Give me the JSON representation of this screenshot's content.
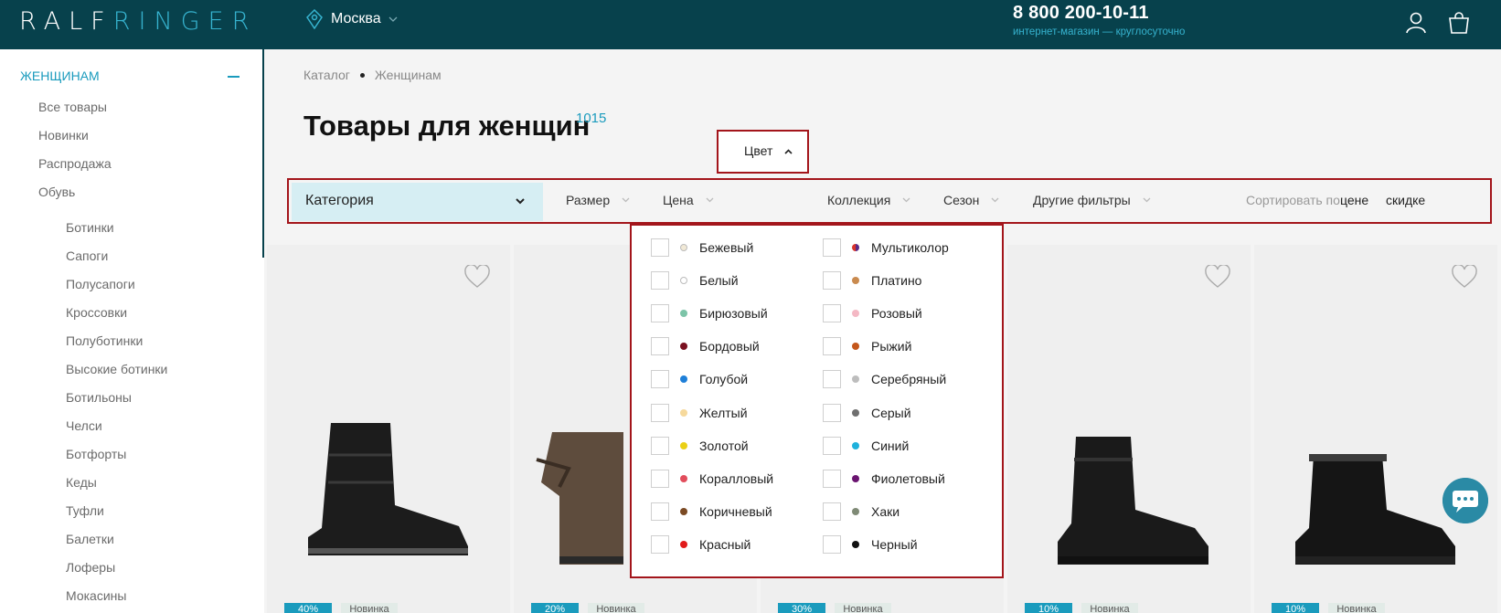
{
  "header": {
    "logo_part1": "RALF",
    "logo_part2": "RINGER",
    "city": "Москва",
    "phone": "8 800 200-10-11",
    "phone_subtitle": "интернет-магазин — круглосуточно"
  },
  "sidebar": {
    "section_title": "ЖЕНЩИНАМ",
    "main_items": [
      "Все товары",
      "Новинки",
      "Распродажа",
      "Обувь"
    ],
    "shoe_items": [
      "Ботинки",
      "Сапоги",
      "Полусапоги",
      "Кроссовки",
      "Полуботинки",
      "Высокие ботинки",
      "Ботильоны",
      "Челси",
      "Ботфорты",
      "Кеды",
      "Туфли",
      "Балетки",
      "Лоферы",
      "Мокасины"
    ]
  },
  "breadcrumb": [
    "Каталог",
    "Женщинам"
  ],
  "page": {
    "title": "Товары для женщин",
    "count": "1015"
  },
  "filters": {
    "category": "Категория",
    "size": "Размер",
    "price": "Цена",
    "color": "Цвет",
    "collection": "Коллекция",
    "season": "Сезон",
    "other": "Другие фильтры",
    "sort_label": "Сортировать по:",
    "sort_price": "цене",
    "sort_discount": "скидке"
  },
  "colors_left": [
    {
      "label": "Бежевый",
      "color": "#f1e9d6",
      "outline": true
    },
    {
      "label": "Белый",
      "color": "#ffffff",
      "outline": true
    },
    {
      "label": "Бирюзовый",
      "color": "#7cc4a8"
    },
    {
      "label": "Бордовый",
      "color": "#7a1020"
    },
    {
      "label": "Голубой",
      "color": "#1e7fd8"
    },
    {
      "label": "Желтый",
      "color": "#f6d99c"
    },
    {
      "label": "Золотой",
      "color": "#ead016"
    },
    {
      "label": "Коралловый",
      "color": "#e24d5c"
    },
    {
      "label": "Коричневый",
      "color": "#7b4a24"
    },
    {
      "label": "Красный",
      "color": "#e11b1b"
    }
  ],
  "colors_right": [
    {
      "label": "Мультиколор",
      "color": "multi"
    },
    {
      "label": "Платино",
      "color": "#c98a4e"
    },
    {
      "label": "Розовый",
      "color": "#f4b8c4"
    },
    {
      "label": "Рыжий",
      "color": "#c4561a"
    },
    {
      "label": "Серебряный",
      "color": "#bdbdbd"
    },
    {
      "label": "Серый",
      "color": "#6f6f6f"
    },
    {
      "label": "Синий",
      "color": "#1eb1dc"
    },
    {
      "label": "Фиолетовый",
      "color": "#6a1470"
    },
    {
      "label": "Хаки",
      "color": "#7f8a76"
    },
    {
      "label": "Черный",
      "color": "#111111"
    }
  ],
  "products": [
    {
      "discount": "40%",
      "badge": "Новинка",
      "boot": "black-quilted"
    },
    {
      "discount": "20%",
      "badge": "Новинка",
      "boot": "brown-suede"
    },
    {
      "discount": "30%",
      "badge": "Новинка",
      "boot": "hidden"
    },
    {
      "discount": "10%",
      "badge": "Новинка",
      "boot": "black-lace"
    },
    {
      "discount": "10%",
      "badge": "Новинка",
      "boot": "black-fur"
    }
  ]
}
